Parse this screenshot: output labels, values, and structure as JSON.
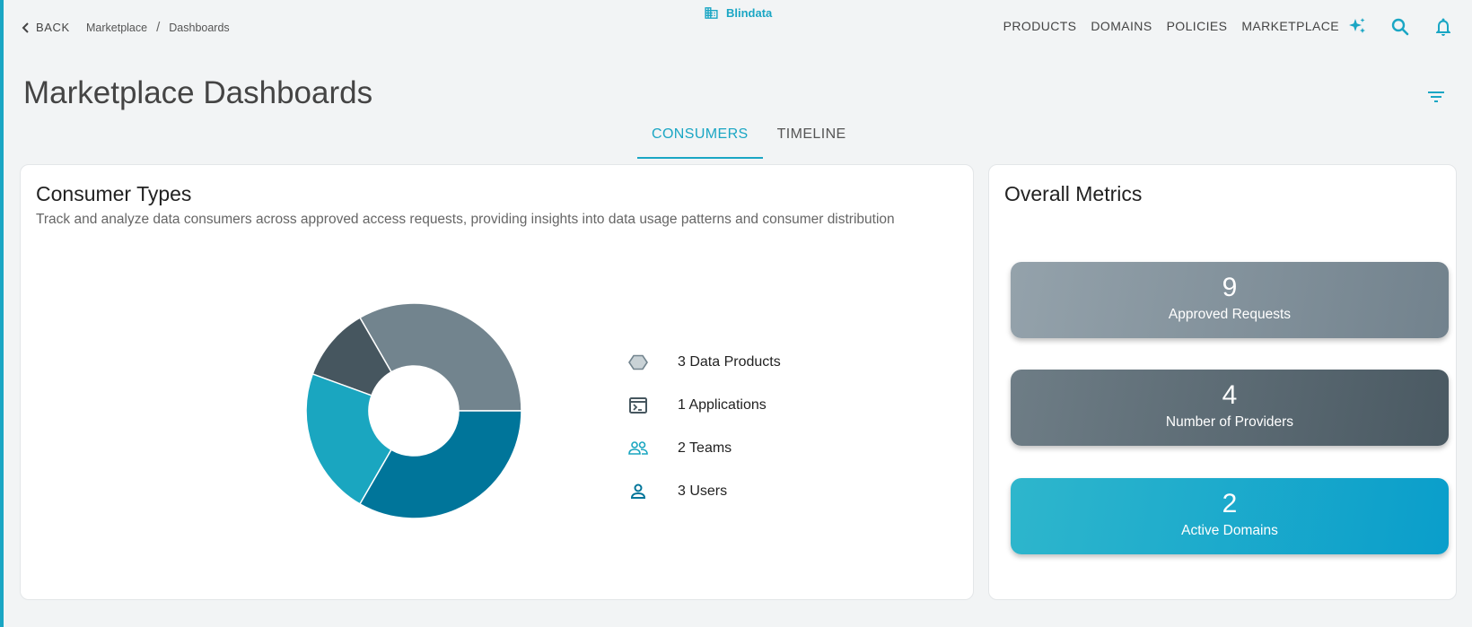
{
  "header": {
    "back_label": "BACK",
    "breadcrumb": [
      "Marketplace",
      "Dashboards"
    ],
    "breadcrumb_sep": "/",
    "brand": "Blindata",
    "nav": [
      "PRODUCTS",
      "DOMAINS",
      "POLICIES",
      "MARKETPLACE"
    ]
  },
  "page": {
    "title": "Marketplace Dashboards",
    "tabs": [
      {
        "label": "CONSUMERS",
        "active": true
      },
      {
        "label": "TIMELINE",
        "active": false
      }
    ]
  },
  "consumer_types": {
    "title": "Consumer Types",
    "subtitle": "Track and analyze data consumers across approved access requests, providing insights into data usage patterns and consumer distribution",
    "legend": [
      {
        "label": "3 Data Products",
        "icon": "hexagon-icon",
        "color": "#72848e"
      },
      {
        "label": "1 Applications",
        "icon": "terminal-icon",
        "color": "#46565f"
      },
      {
        "label": "2 Teams",
        "icon": "people-icon",
        "color": "#1aa6c0"
      },
      {
        "label": "3 Users",
        "icon": "person-icon",
        "color": "#00759a"
      }
    ]
  },
  "chart_data": {
    "type": "pie",
    "categories": [
      "Data Products",
      "Applications",
      "Teams",
      "Users"
    ],
    "values": [
      3,
      1,
      2,
      3
    ],
    "colors": [
      "#72848e",
      "#46565f",
      "#1aa6c0",
      "#00759a"
    ]
  },
  "overall_metrics": {
    "title": "Overall Metrics",
    "items": [
      {
        "value": "9",
        "label": "Approved Requests"
      },
      {
        "value": "4",
        "label": "Number of Providers"
      },
      {
        "value": "2",
        "label": "Active Domains"
      }
    ]
  },
  "colors": {
    "accent": "#1aa6c4",
    "background": "#f2f4f5"
  }
}
